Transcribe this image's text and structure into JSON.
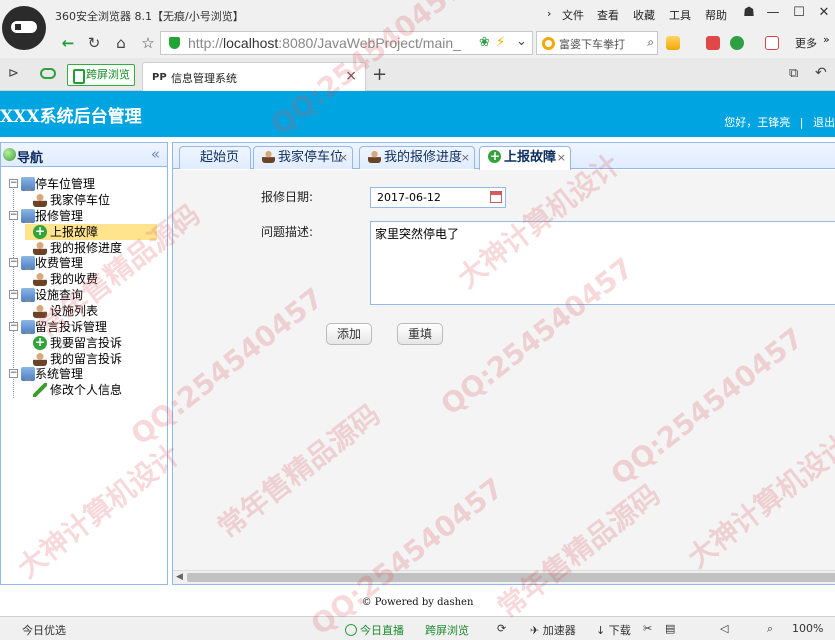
{
  "browser": {
    "title": "360安全浏览器 8.1【无痕/小号浏览】",
    "menu": [
      "文件",
      "查看",
      "收藏",
      "工具",
      "帮助"
    ],
    "url_host": "localhost",
    "url_rest": ":8080/JavaWebProject/main_",
    "search_text": "富婆下车拳打",
    "more": "更多",
    "tab_split": "跨屏浏览",
    "tab_active": "信息管理系统",
    "tab_active_icon": "PP"
  },
  "app": {
    "title": "XXX系统后台管理",
    "user_greeting": "您好，王锋亮",
    "separator": "|",
    "logout": "退出"
  },
  "sidebar": {
    "header": "导航",
    "collapse": "«",
    "tree": [
      {
        "label": "停车位管理",
        "children": [
          "我家停车位"
        ]
      },
      {
        "label": "报修管理",
        "children": [
          "上报故障",
          "我的报修进度"
        ]
      },
      {
        "label": "收费管理",
        "children": [
          "我的收费"
        ]
      },
      {
        "label": "设施查询",
        "children": [
          "设施列表"
        ]
      },
      {
        "label": "留言投诉管理",
        "children": [
          "我要留言投诉",
          "我的留言投诉"
        ]
      },
      {
        "label": "系统管理",
        "children": [
          "修改个人信息"
        ]
      }
    ]
  },
  "tabs": [
    {
      "label": "起始页"
    },
    {
      "label": "我家停车位"
    },
    {
      "label": "我的报修进度"
    },
    {
      "label": "上报故障",
      "active": true
    }
  ],
  "form": {
    "date_label": "报修日期:",
    "date_value": "2017-06-12",
    "desc_label": "问题描述:",
    "desc_value": "家里突然停电了",
    "add_button": "添加",
    "reset_button": "重填"
  },
  "footer": "© Powered by dashen",
  "statusbar": {
    "left": "今日优选",
    "live": "今日直播",
    "split": "跨屏浏览",
    "accel": "加速器",
    "download": "下载",
    "zoom": "100%"
  },
  "watermarks": [
    "QQ:254540457",
    "大神计算机设计",
    "常年售精品源码"
  ]
}
